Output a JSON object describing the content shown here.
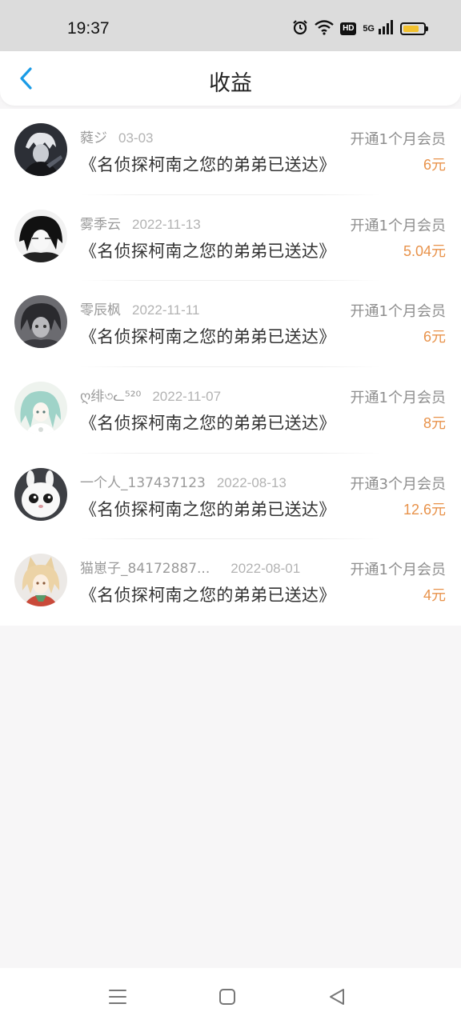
{
  "status_bar": {
    "time": "19:37",
    "hd_label": "HD",
    "network_label": "5G",
    "battery_level": 0.8,
    "battery_color": "#f2c12e"
  },
  "header": {
    "title": "收益",
    "back_icon": "chevron-left-icon",
    "accent_color": "#1a9be6"
  },
  "earnings": {
    "items": [
      {
        "user": "蕤ジ",
        "date": "03-03",
        "title": "《名侦探柯南之您的弟弟已送达》",
        "action": "开通1个月会员",
        "amount": "6元"
      },
      {
        "user": "雾季云",
        "date": "2022-11-13",
        "title": "《名侦探柯南之您的弟弟已送达》",
        "action": "开通1个月会员",
        "amount": "5.04元"
      },
      {
        "user": "零辰枫",
        "date": "2022-11-11",
        "title": "《名侦探柯南之您的弟弟已送达》",
        "action": "开通1个月会员",
        "amount": "6元"
      },
      {
        "user": "ღ绯৩ᓚ⁵²⁰",
        "date": "2022-11-07",
        "title": "《名侦探柯南之您的弟弟已送达》",
        "action": "开通1个月会员",
        "amount": "8元"
      },
      {
        "user": "一个人_137437123",
        "date": "2022-08-13",
        "title": "《名侦探柯南之您的弟弟已送达》",
        "action": "开通3个月会员",
        "amount": "12.6元"
      },
      {
        "user": "猫崽子_84172887...",
        "date": "2022-08-01",
        "title": "《名侦探柯南之您的弟弟已送达》",
        "action": "开通1个月会员",
        "amount": "4元"
      }
    ]
  },
  "nav_bar": {
    "menu_icon": "menu-icon",
    "home_icon": "home-square-icon",
    "back_icon": "back-triangle-icon"
  }
}
